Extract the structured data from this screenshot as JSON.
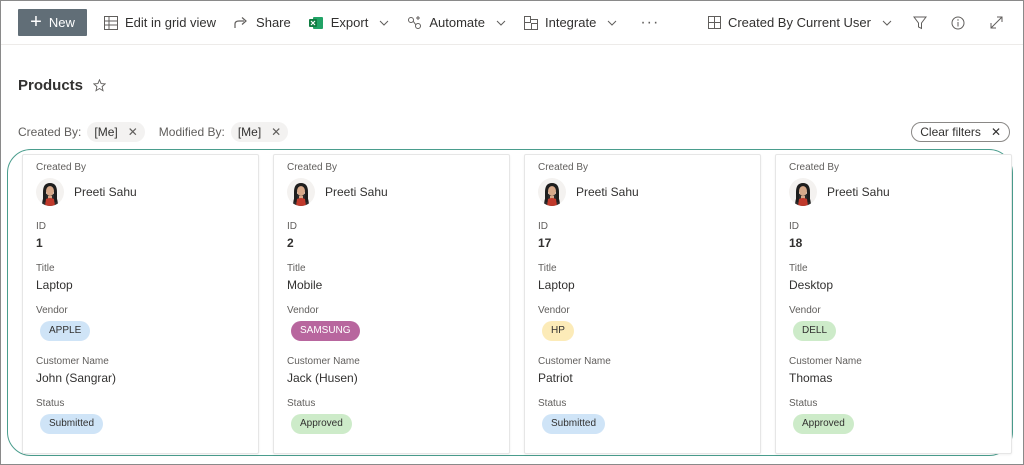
{
  "toolbar": {
    "new_label": "New",
    "edit_grid_label": "Edit in grid view",
    "share_label": "Share",
    "export_label": "Export",
    "automate_label": "Automate",
    "integrate_label": "Integrate",
    "more_label": "···",
    "view_label": "Created By Current User"
  },
  "page": {
    "title": "Products"
  },
  "filters": {
    "created_by_label": "Created By:",
    "created_by_value": "[Me]",
    "modified_by_label": "Modified By:",
    "modified_by_value": "[Me]",
    "clear_label": "Clear filters"
  },
  "labels": {
    "created_by": "Created By",
    "id": "ID",
    "title": "Title",
    "vendor": "Vendor",
    "customer": "Customer Name",
    "status": "Status"
  },
  "colors": {
    "accent_outline": "#4a9d8d",
    "new_button": "#616e77"
  },
  "cards": [
    {
      "created_by": "Preeti Sahu",
      "id": "1",
      "title": "Laptop",
      "vendor": "APPLE",
      "vendor_bg": "#cfe4f7",
      "vendor_fg": "#323130",
      "customer": "John (Sangrar)",
      "status": "Submitted",
      "status_bg": "#cfe4f7",
      "status_fg": "#323130"
    },
    {
      "created_by": "Preeti Sahu",
      "id": "2",
      "title": "Mobile",
      "vendor": "SAMSUNG",
      "vendor_bg": "#b8669e",
      "vendor_fg": "#ffffff",
      "customer": "Jack (Husen)",
      "status": "Approved",
      "status_bg": "#cdebc9",
      "status_fg": "#323130"
    },
    {
      "created_by": "Preeti Sahu",
      "id": "17",
      "title": "Laptop",
      "vendor": "HP",
      "vendor_bg": "#fcebb8",
      "vendor_fg": "#323130",
      "customer": "Patriot",
      "status": "Submitted",
      "status_bg": "#cfe4f7",
      "status_fg": "#323130"
    },
    {
      "created_by": "Preeti Sahu",
      "id": "18",
      "title": "Desktop",
      "vendor": "DELL",
      "vendor_bg": "#cdebc9",
      "vendor_fg": "#323130",
      "customer": "Thomas",
      "status": "Approved",
      "status_bg": "#cdebc9",
      "status_fg": "#323130"
    }
  ]
}
